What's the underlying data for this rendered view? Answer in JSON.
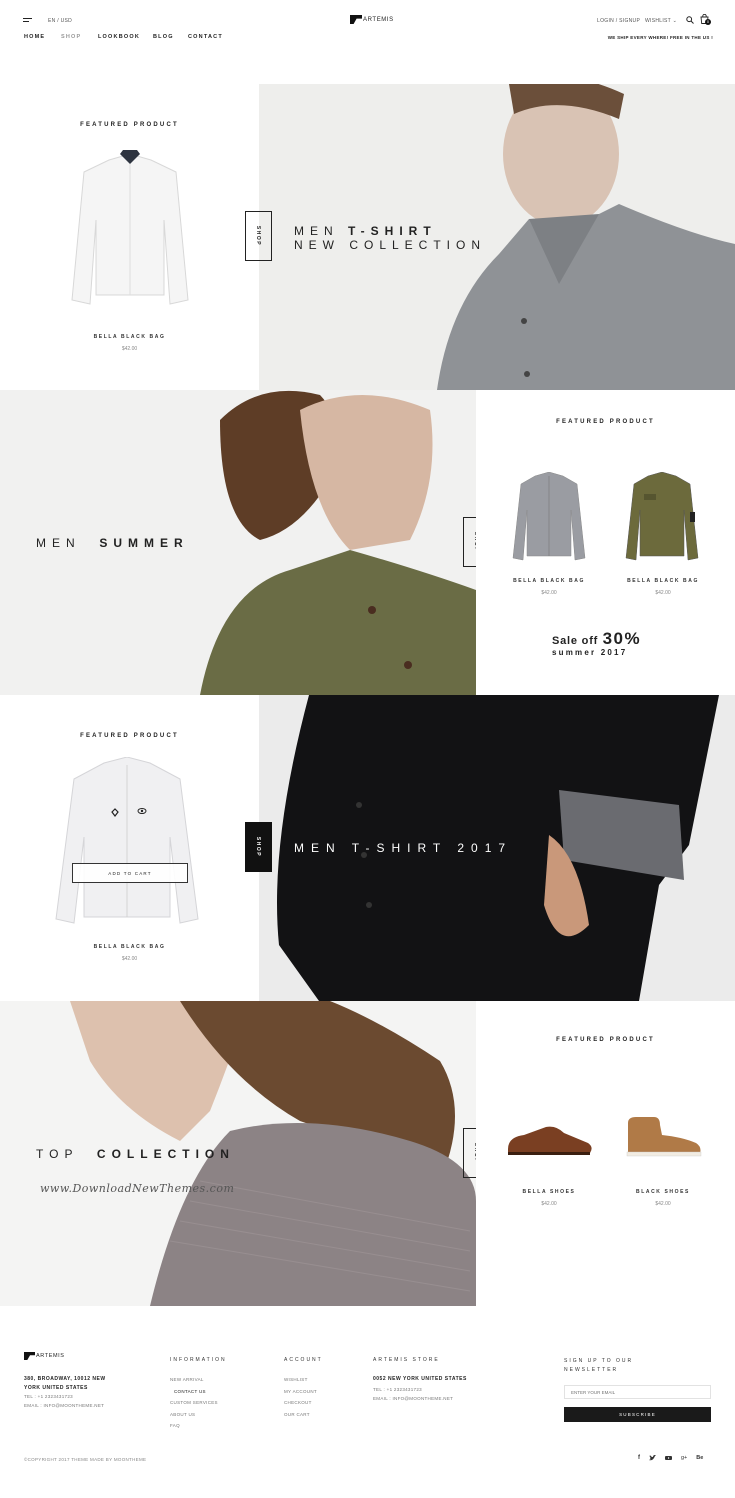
{
  "header": {
    "lang_currency": "EN / USD",
    "brand": "ARTEMIS",
    "login": "LOGIN / SIGNUP",
    "wishlist": "WISHLIST",
    "cart_count": "0",
    "shipping_note": "WE SHIP EVERY WHERE! FREE IN THE US !",
    "nav": [
      "HOME",
      "SHOP",
      "LOOKBOOK",
      "BLOG",
      "CONTACT"
    ]
  },
  "section1": {
    "label": "FEATURED PRODUCT",
    "product": {
      "name": "BELLA BLACK BAG",
      "price": "$42.00"
    },
    "shop": "SHOP",
    "hero_line1_a": "MEN",
    "hero_line1_b": "T-SHIRT",
    "hero_line2": "NEW COLLECTION"
  },
  "section2": {
    "hero_a": "MEN",
    "hero_b": "SUMMER",
    "shop": "SHOP",
    "label": "FEATURED PRODUCT",
    "products": [
      {
        "name": "BELLA BLACK BAG",
        "price": "$42.00"
      },
      {
        "name": "BELLA BLACK BAG",
        "price": "$42.00"
      }
    ],
    "sale_prefix": "Sale off",
    "sale_pct": "30%",
    "sale_sub": "summer 2017"
  },
  "section3": {
    "label": "FEATURED PRODUCT",
    "add_to_cart": "ADD TO CART",
    "product": {
      "name": "BELLA BLACK BAG",
      "price": "$42.00"
    },
    "shop": "SHOP",
    "hero": "MEN T-SHIRT 2017"
  },
  "section4": {
    "hero_a": "TOP",
    "hero_b": "COLLECTION",
    "watermark": "www.DownloadNewThemes.com",
    "shop": "SHOP",
    "label": "FEATURED PRODUCT",
    "products": [
      {
        "name": "BELLA SHOES",
        "price": "$42.00"
      },
      {
        "name": "BLACK SHOES",
        "price": "$42.00"
      }
    ]
  },
  "footer": {
    "brand": "ARTEMIS",
    "address": "380, BROADWAY, 10012 NEW YORK UNITED STATES",
    "tel": "TEL : +1 2323431723",
    "email": "EMAIL : INFO@MOONTHEME.NET",
    "information_head": "INFORMATION",
    "information": [
      "NEW ARRIVAL",
      "CONTACT US",
      "CUSTOM SERVICES",
      "ABOUT US",
      "FAQ"
    ],
    "account_head": "ACCOUNT",
    "account": [
      "WISHLIST",
      "MY ACCOUNT",
      "CHECKOUT",
      "OUR CART"
    ],
    "store_head": "ARTEMIS STORE",
    "store_address": "0052 NEW YORK UNITED STATES",
    "store_tel": "TEL : +1 2323431723",
    "store_email": "EMAIL : INFO@MOONTHEME.NET",
    "newsletter_head": "SIGN UP TO OUR NEWSLETTER",
    "newsletter_placeholder": "ENTER YOUR EMAIL",
    "subscribe": "SUBSCRIBE",
    "copyright": "©COPYRIGHT 2017 THEME MADE BY MOONTHEME",
    "social_icons": [
      "facebook-icon",
      "twitter-icon",
      "youtube-icon",
      "google-plus-icon",
      "behance-icon"
    ]
  }
}
